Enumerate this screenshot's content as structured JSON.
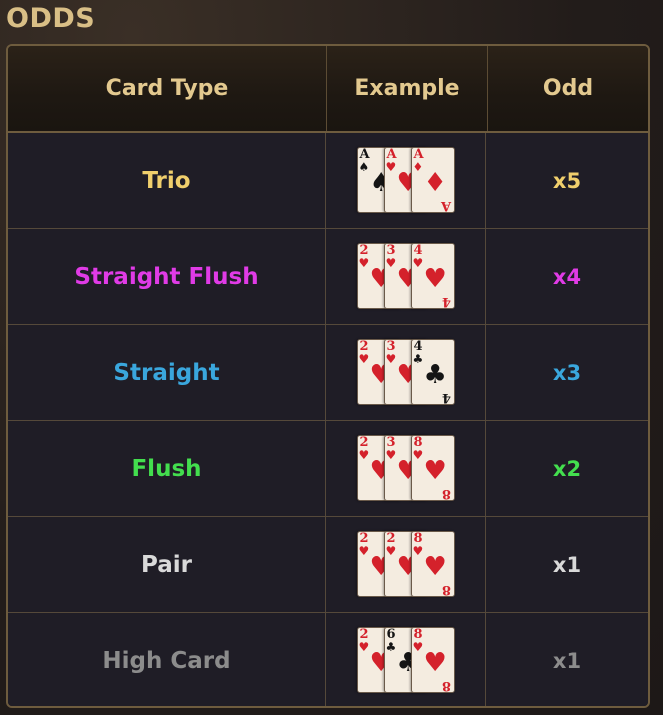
{
  "title": "ODDS",
  "headers": {
    "type": "Card Type",
    "example": "Example",
    "odd": "Odd"
  },
  "rows": [
    {
      "type": "Trio",
      "odd": "x5",
      "color": "#f0cf6c",
      "cards": [
        {
          "rank": "A",
          "suit": "♠",
          "color": "black"
        },
        {
          "rank": "A",
          "suit": "♥",
          "color": "red"
        },
        {
          "rank": "A",
          "suit": "♦",
          "color": "red"
        }
      ]
    },
    {
      "type": "Straight Flush",
      "odd": "x4",
      "color": "#e03be6",
      "cards": [
        {
          "rank": "2",
          "suit": "♥",
          "color": "red"
        },
        {
          "rank": "3",
          "suit": "♥",
          "color": "red"
        },
        {
          "rank": "4",
          "suit": "♥",
          "color": "red"
        }
      ]
    },
    {
      "type": "Straight",
      "odd": "x3",
      "color": "#3aa7dd",
      "cards": [
        {
          "rank": "2",
          "suit": "♥",
          "color": "red"
        },
        {
          "rank": "3",
          "suit": "♥",
          "color": "red"
        },
        {
          "rank": "4",
          "suit": "♣",
          "color": "black"
        }
      ]
    },
    {
      "type": "Flush",
      "odd": "x2",
      "color": "#43de4e",
      "cards": [
        {
          "rank": "2",
          "suit": "♥",
          "color": "red"
        },
        {
          "rank": "3",
          "suit": "♥",
          "color": "red"
        },
        {
          "rank": "8",
          "suit": "♥",
          "color": "red"
        }
      ]
    },
    {
      "type": "Pair",
      "odd": "x1",
      "color": "#d9d9d9",
      "cards": [
        {
          "rank": "2",
          "suit": "♥",
          "color": "red"
        },
        {
          "rank": "2",
          "suit": "♥",
          "color": "red"
        },
        {
          "rank": "8",
          "suit": "♥",
          "color": "red"
        }
      ]
    },
    {
      "type": "High Card",
      "odd": "x1",
      "color": "#8c8c8c",
      "cards": [
        {
          "rank": "2",
          "suit": "♥",
          "color": "red"
        },
        {
          "rank": "6",
          "suit": "♣",
          "color": "black"
        },
        {
          "rank": "8",
          "suit": "♥",
          "color": "red"
        }
      ]
    }
  ]
}
